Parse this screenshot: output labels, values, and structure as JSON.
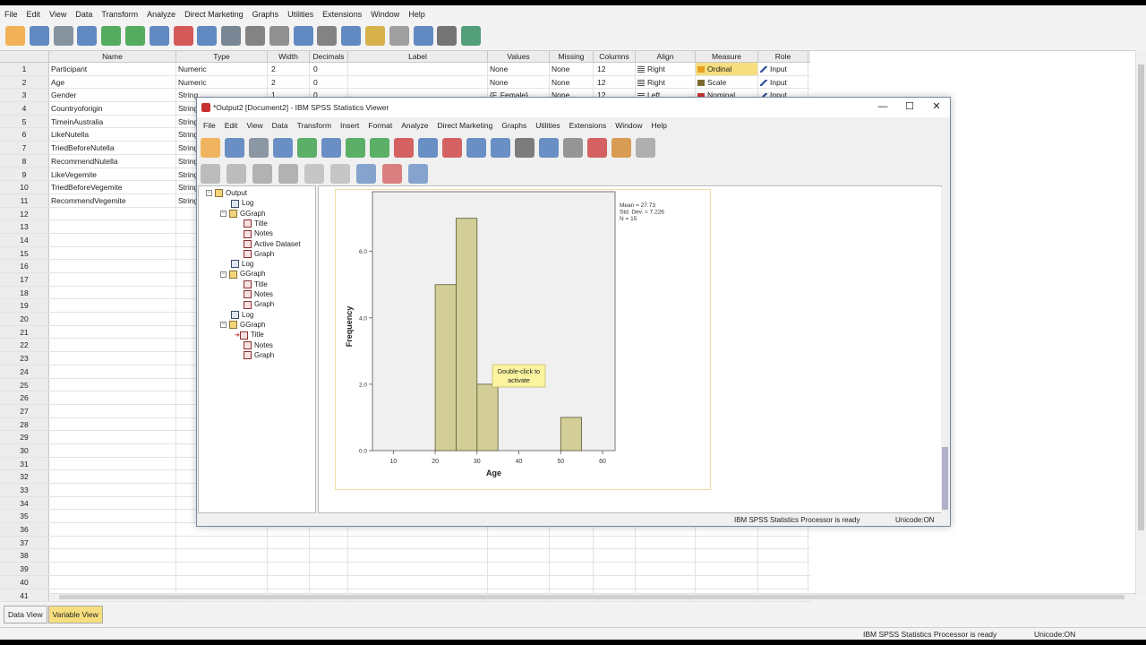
{
  "menu": [
    "File",
    "Edit",
    "View",
    "Data",
    "Transform",
    "Analyze",
    "Direct Marketing",
    "Graphs",
    "Utilities",
    "Extensions",
    "Window",
    "Help"
  ],
  "columns": [
    "Name",
    "Type",
    "Width",
    "Decimals",
    "Label",
    "Values",
    "Missing",
    "Columns",
    "Align",
    "Measure",
    "Role"
  ],
  "variables": [
    {
      "num": "1",
      "name": "Participant",
      "type": "Numeric",
      "width": "2",
      "decimals": "0",
      "label": "",
      "values": "None",
      "missing": "None",
      "columns": "12",
      "align": "Right",
      "measure": "Ordinal",
      "role": "Input"
    },
    {
      "num": "2",
      "name": "Age",
      "type": "Numeric",
      "width": "2",
      "decimals": "0",
      "label": "",
      "values": "None",
      "missing": "None",
      "columns": "12",
      "align": "Right",
      "measure": "Scale",
      "role": "Input"
    },
    {
      "num": "3",
      "name": "Gender",
      "type": "String",
      "width": "1",
      "decimals": "0",
      "label": "",
      "values": "{F, Female}...",
      "missing": "None",
      "columns": "12",
      "align": "Left",
      "measure": "Nominal",
      "role": "Input"
    },
    {
      "num": "4",
      "name": "Countryoforigin",
      "type": "String"
    },
    {
      "num": "5",
      "name": "TimeinAustralia",
      "type": "String"
    },
    {
      "num": "6",
      "name": "LikeNutella",
      "type": "String"
    },
    {
      "num": "7",
      "name": "TriedBeforeNutella",
      "type": "String"
    },
    {
      "num": "8",
      "name": "RecommendNutella",
      "type": "String"
    },
    {
      "num": "9",
      "name": "LikeVegemite",
      "type": "String"
    },
    {
      "num": "10",
      "name": "TriedBeforeVegemite",
      "type": "String"
    },
    {
      "num": "11",
      "name": "RecommendVegemite",
      "type": "String"
    }
  ],
  "empty_rows": [
    "12",
    "13",
    "14",
    "15",
    "16",
    "17",
    "18",
    "19",
    "20",
    "21",
    "22",
    "23",
    "24",
    "25",
    "26",
    "27",
    "28",
    "29",
    "30",
    "31",
    "32",
    "33",
    "34",
    "35",
    "36",
    "37",
    "38",
    "39",
    "40",
    "41"
  ],
  "tabs": {
    "data_view": "Data View",
    "variable_view": "Variable View"
  },
  "status": {
    "processor": "IBM SPSS Statistics Processor is ready",
    "unicode": "Unicode:ON"
  },
  "viewer": {
    "title": "*Output2 [Document2] - IBM SPSS Statistics Viewer",
    "menu": [
      "File",
      "Edit",
      "View",
      "Data",
      "Transform",
      "Insert",
      "Format",
      "Analyze",
      "Direct Marketing",
      "Graphs",
      "Utilities",
      "Extensions",
      "Window",
      "Help"
    ],
    "outline": [
      {
        "label": "Output",
        "level": 0,
        "kind": "book",
        "toggle": "−"
      },
      {
        "label": "Log",
        "level": 1,
        "kind": "log"
      },
      {
        "label": "GGraph",
        "level": 1,
        "kind": "book",
        "toggle": "−"
      },
      {
        "label": "Title",
        "level": 2,
        "kind": "page"
      },
      {
        "label": "Notes",
        "level": 2,
        "kind": "page"
      },
      {
        "label": "Active Dataset",
        "level": 2,
        "kind": "page"
      },
      {
        "label": "Graph",
        "level": 2,
        "kind": "page"
      },
      {
        "label": "Log",
        "level": 1,
        "kind": "log"
      },
      {
        "label": "GGraph",
        "level": 1,
        "kind": "book",
        "toggle": "−"
      },
      {
        "label": "Title",
        "level": 2,
        "kind": "page"
      },
      {
        "label": "Notes",
        "level": 2,
        "kind": "page"
      },
      {
        "label": "Graph",
        "level": 2,
        "kind": "page"
      },
      {
        "label": "Log",
        "level": 1,
        "kind": "log"
      },
      {
        "label": "GGraph",
        "level": 1,
        "kind": "book",
        "toggle": "−"
      },
      {
        "label": "Title",
        "level": 2,
        "kind": "page",
        "current": true
      },
      {
        "label": "Notes",
        "level": 2,
        "kind": "page"
      },
      {
        "label": "Graph",
        "level": 2,
        "kind": "page"
      }
    ],
    "tooltip": "Double-click to activate",
    "status_processor": "IBM SPSS Statistics Processor is ready",
    "status_unicode": "Unicode:ON"
  },
  "chart_data": {
    "type": "bar",
    "bins": [
      {
        "x0": 20,
        "x1": 25,
        "count": 5
      },
      {
        "x0": 25,
        "x1": 30,
        "count": 7
      },
      {
        "x0": 30,
        "x1": 35,
        "count": 2
      },
      {
        "x0": 50,
        "x1": 55,
        "count": 1
      }
    ],
    "xlabel": "Age",
    "ylabel": "Frequency",
    "xticks": [
      "10",
      "20",
      "30",
      "40",
      "50",
      "60"
    ],
    "yticks": [
      "0.0",
      "2.0",
      "4.0",
      "6.0"
    ],
    "xlim": [
      5,
      63
    ],
    "ylim": [
      0,
      7.8
    ],
    "stats": [
      "Mean = 27.73",
      "Std. Dev. = 7.226",
      "N = 15"
    ],
    "bar_color": "#d3ce97",
    "bar_edge": "#5a5a3a",
    "plot_bg": "#f0f0f0"
  }
}
